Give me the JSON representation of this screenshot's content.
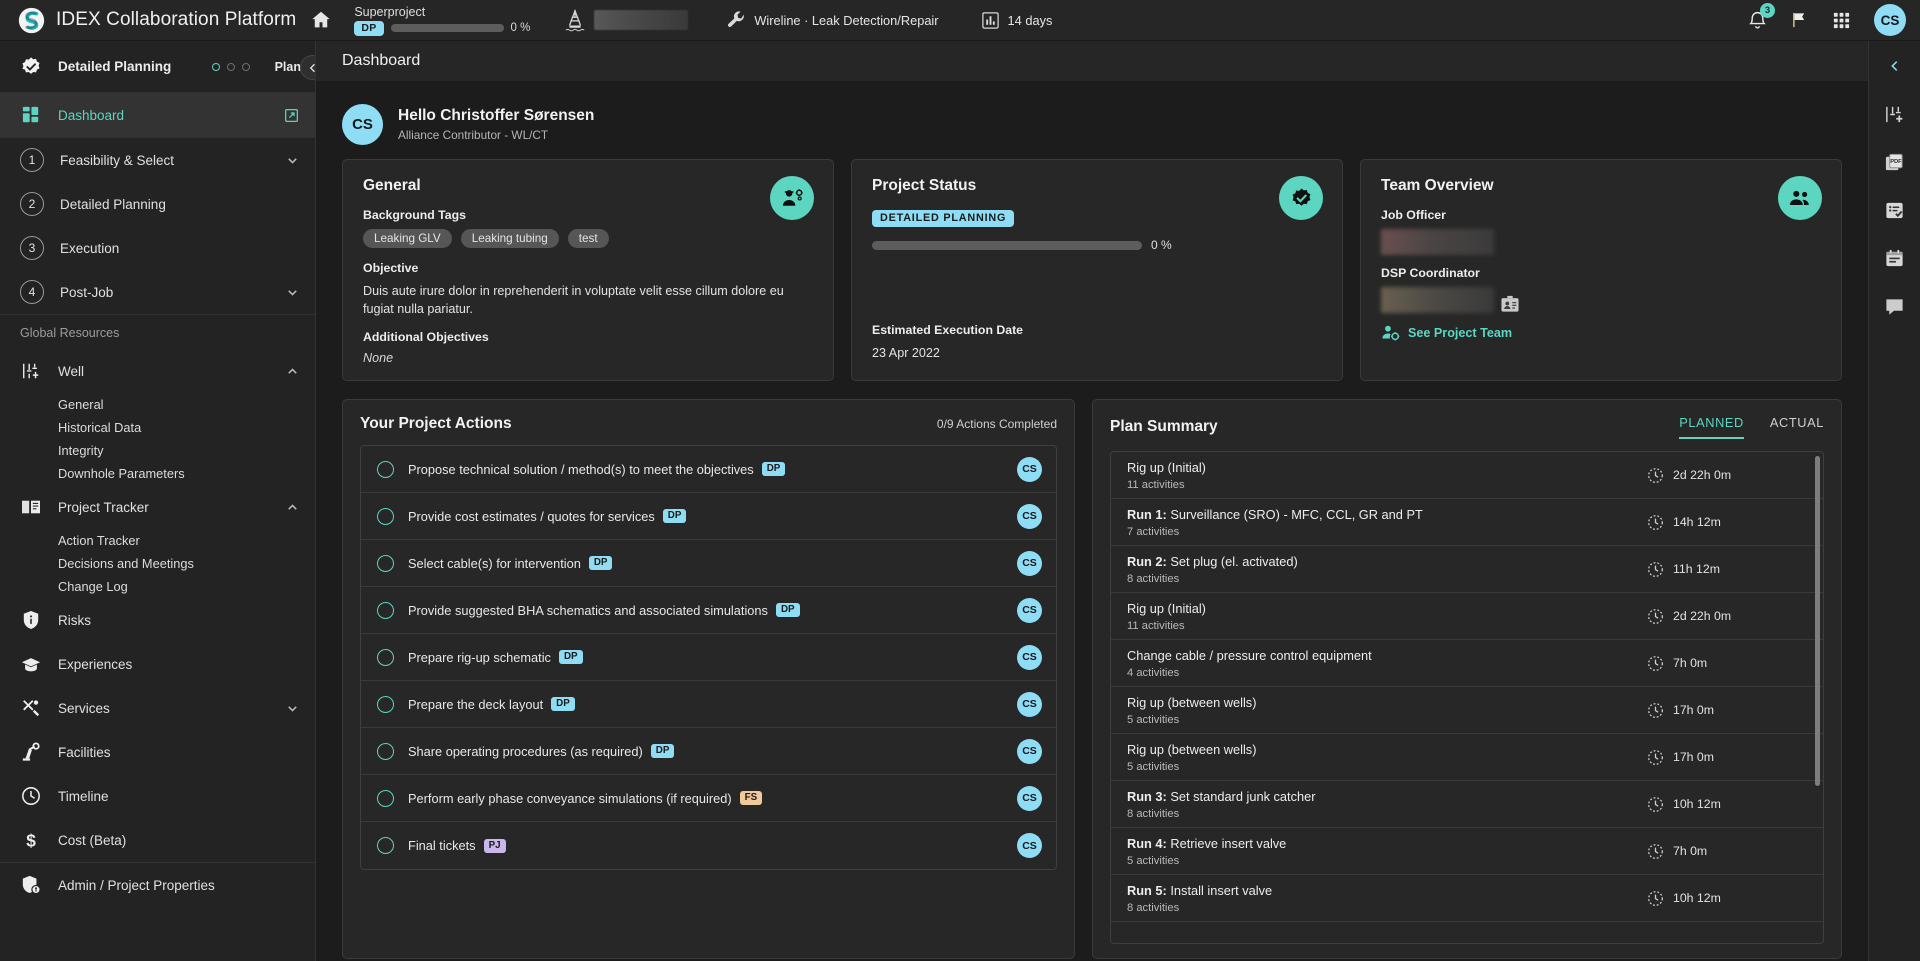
{
  "topbar": {
    "brand": "IDEX Collaboration Platform",
    "home_icon": "home-icon",
    "project_name": "Superproject",
    "project_phase_chip": "DP",
    "project_progress_pct": "0 %",
    "rig_icon": "offshore-rig-icon",
    "asset_name_redacted": "",
    "wrench_icon": "wrench-icon",
    "service_line": "Wireline · Leak Detection/Repair",
    "chart_icon": "bar-chart-icon",
    "duration": "14 days",
    "bell_icon": "bell-icon",
    "notification_count": "3",
    "flag_icon": "flag-icon",
    "apps_icon": "apps-grid-icon",
    "user_initials": "CS"
  },
  "sidebar": {
    "phase_header": {
      "icon": "verified-badge-icon",
      "label": "Detailed Planning",
      "dots": [
        "on",
        "off",
        "off"
      ],
      "plan_label": "Plan",
      "collapse_icon": "chevron-left-icon"
    },
    "dashboard": {
      "icon": "dashboard-grid-icon",
      "label": "Dashboard",
      "external_icon": "open-external-icon"
    },
    "phases": [
      {
        "num": "1",
        "label": "Feasibility & Select",
        "chevron": "chevron-down-icon"
      },
      {
        "num": "2",
        "label": "Detailed Planning",
        "chevron": ""
      },
      {
        "num": "3",
        "label": "Execution",
        "chevron": ""
      },
      {
        "num": "4",
        "label": "Post-Job",
        "chevron": "chevron-down-icon"
      }
    ],
    "global_resources_title": "Global Resources",
    "groups": [
      {
        "icon": "well-icon",
        "label": "Well",
        "chevron": "chevron-up-icon",
        "children": [
          "General",
          "Historical Data",
          "Integrity",
          "Downhole Parameters"
        ]
      },
      {
        "icon": "book-icon",
        "label": "Project Tracker",
        "chevron": "chevron-up-icon",
        "children": [
          "Action Tracker",
          "Decisions and Meetings",
          "Change Log"
        ]
      }
    ],
    "items": [
      {
        "icon": "shield-info-icon",
        "label": "Risks",
        "chevron": ""
      },
      {
        "icon": "graduation-cap-icon",
        "label": "Experiences",
        "chevron": ""
      },
      {
        "icon": "tools-icon",
        "label": "Services",
        "chevron": "chevron-down-icon"
      },
      {
        "icon": "robot-arm-icon",
        "label": "Facilities",
        "chevron": ""
      },
      {
        "icon": "clock-icon",
        "label": "Timeline",
        "chevron": ""
      },
      {
        "icon": "dollar-icon",
        "label": "Cost (Beta)",
        "chevron": ""
      }
    ],
    "admin": {
      "icon": "admin-shield-icon",
      "label": "Admin / Project Properties"
    }
  },
  "page": {
    "title": "Dashboard",
    "greeting": {
      "avatar_initials": "CS",
      "name": "Hello Christoffer Sørensen",
      "role": "Alliance Contributor - WL/CT"
    }
  },
  "general_card": {
    "title": "General",
    "icon": "engineer-settings-icon",
    "background_tags_label": "Background Tags",
    "tags": [
      "Leaking GLV",
      "Leaking tubing",
      "test"
    ],
    "objective_label": "Objective",
    "objective_text": "Duis aute irure dolor in reprehenderit in voluptate velit esse cillum dolore eu fugiat nulla pariatur.",
    "additional_objectives_label": "Additional Objectives",
    "additional_objectives_value": "None"
  },
  "status_card": {
    "title": "Project Status",
    "icon": "verified-check-icon",
    "phase_badge": "DETAILED PLANNING",
    "progress_pct": "0 %",
    "estimated_date_label": "Estimated Execution Date",
    "estimated_date_value": "23 Apr 2022"
  },
  "team_card": {
    "title": "Team Overview",
    "icon": "people-group-icon",
    "job_officer_label": "Job Officer",
    "job_officer_value": "",
    "dsp_coordinator_label": "DSP Coordinator",
    "dsp_coordinator_value": "",
    "badge_icon": "id-card-icon",
    "see_team_icon": "person-gear-icon",
    "see_team_label": "See Project Team"
  },
  "actions_panel": {
    "title": "Your Project Actions",
    "completed_text": "0/9 Actions Completed",
    "avatar_initials": "CS",
    "items": [
      {
        "label": "Propose technical solution / method(s) to meet the objectives",
        "chip": "DP",
        "chip_type": "dp"
      },
      {
        "label": "Provide cost estimates / quotes for services",
        "chip": "DP",
        "chip_type": "dp"
      },
      {
        "label": "Select cable(s) for intervention",
        "chip": "DP",
        "chip_type": "dp"
      },
      {
        "label": "Provide suggested BHA schematics and associated simulations",
        "chip": "DP",
        "chip_type": "dp"
      },
      {
        "label": "Prepare rig-up schematic",
        "chip": "DP",
        "chip_type": "dp"
      },
      {
        "label": "Prepare the deck layout",
        "chip": "DP",
        "chip_type": "dp"
      },
      {
        "label": "Share operating procedures (as required)",
        "chip": "DP",
        "chip_type": "dp"
      },
      {
        "label": "Perform early phase conveyance simulations (if required)",
        "chip": "FS",
        "chip_type": "fs"
      },
      {
        "label": "Final tickets",
        "chip": "PJ",
        "chip_type": "pj"
      }
    ]
  },
  "plan_panel": {
    "title": "Plan Summary",
    "tabs": [
      {
        "label": "PLANNED",
        "active": true
      },
      {
        "label": "ACTUAL",
        "active": false
      }
    ],
    "clock_icon": "clock-dashed-icon",
    "rows": [
      {
        "prefix": "",
        "name": "Rig up (Initial)",
        "activities": "11 activities",
        "duration": "2d 22h 0m"
      },
      {
        "prefix": "Run 1:",
        "name": "Surveillance (SRO) - MFC, CCL, GR and PT",
        "activities": "7 activities",
        "duration": "14h 12m"
      },
      {
        "prefix": "Run 2:",
        "name": "Set plug (el. activated)",
        "activities": "8 activities",
        "duration": "11h 12m"
      },
      {
        "prefix": "",
        "name": "Rig up (Initial)",
        "activities": "11 activities",
        "duration": "2d 22h 0m"
      },
      {
        "prefix": "",
        "name": "Change cable / pressure control equipment",
        "activities": "4 activities",
        "duration": "7h 0m"
      },
      {
        "prefix": "",
        "name": "Rig up (between wells)",
        "activities": "5 activities",
        "duration": "17h 0m"
      },
      {
        "prefix": "",
        "name": "Rig up (between wells)",
        "activities": "5 activities",
        "duration": "17h 0m"
      },
      {
        "prefix": "Run 3:",
        "name": "Set standard junk catcher",
        "activities": "8 activities",
        "duration": "10h 12m"
      },
      {
        "prefix": "Run 4:",
        "name": "Retrieve insert valve",
        "activities": "5 activities",
        "duration": "7h 0m"
      },
      {
        "prefix": "Run 5:",
        "name": "Install insert valve",
        "activities": "8 activities",
        "duration": "10h 12m"
      }
    ]
  },
  "rail": {
    "items": [
      {
        "icon": "chevron-left-icon"
      },
      {
        "icon": "well-add-icon"
      },
      {
        "icon": "pdf-document-icon"
      },
      {
        "icon": "checklist-icon"
      },
      {
        "icon": "calendar-icon"
      },
      {
        "icon": "comment-icon"
      }
    ]
  },
  "colors": {
    "accent_teal": "#5cd6c0",
    "accent_blue": "#8fdcf5",
    "panel_bg": "#272727",
    "page_bg": "#1c1c1c",
    "sidebar_bg": "#232323"
  }
}
